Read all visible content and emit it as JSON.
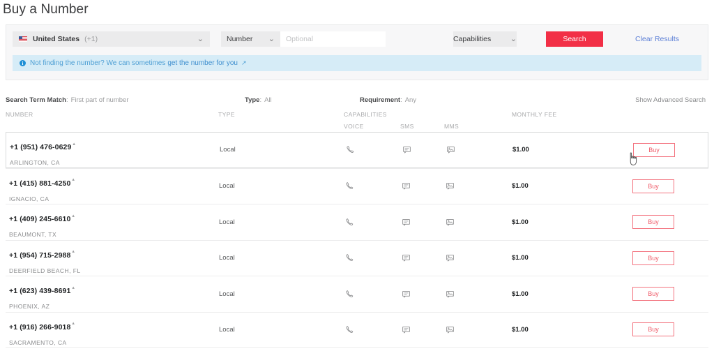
{
  "page_title": "Buy a Number",
  "search": {
    "country": {
      "icon": "us-flag-icon",
      "name": "United States",
      "dial_code": "(+1)",
      "chevron": "⌄"
    },
    "type_select": {
      "value": "Number",
      "chevron": "⌄"
    },
    "term_input": {
      "value": "",
      "placeholder": "Optional"
    },
    "capabilities_button": {
      "label": "Capabilities",
      "chevron": "⌄"
    },
    "search_button": "Search",
    "clear_results": "Clear Results"
  },
  "info_banner": {
    "icon": "info-icon",
    "text": "Not finding the number? We can sometimes",
    "link_text": "get the number for you",
    "external_arrow": "↗"
  },
  "filters": {
    "search_term_match": {
      "label": "Search Term Match",
      "value": "First part of number"
    },
    "type": {
      "label": "Type",
      "value": "All"
    },
    "requirement": {
      "label": "Requirement",
      "value": "Any"
    },
    "advanced_search_link": "Show Advanced Search"
  },
  "table": {
    "headers": {
      "number": "NUMBER",
      "type": "TYPE",
      "capabilities": "CAPABILITIES",
      "voice": "VOICE",
      "sms": "SMS",
      "mms": "MMS",
      "monthly_fee": "MONTHLY FEE"
    },
    "buy_label": "Buy",
    "superscript": "▴",
    "rows": [
      {
        "number": "+1 (951) 476-0629",
        "location": "ARLINGTON, CA",
        "type": "Local",
        "voice": true,
        "sms": true,
        "mms": true,
        "monthly_fee": "$1.00",
        "hovered": true
      },
      {
        "number": "+1 (415) 881-4250",
        "location": "IGNACIO, CA",
        "type": "Local",
        "voice": true,
        "sms": true,
        "mms": true,
        "monthly_fee": "$1.00",
        "hovered": false
      },
      {
        "number": "+1 (409) 245-6610",
        "location": "BEAUMONT, TX",
        "type": "Local",
        "voice": true,
        "sms": true,
        "mms": true,
        "monthly_fee": "$1.00",
        "hovered": false
      },
      {
        "number": "+1 (954) 715-2988",
        "location": "DEERFIELD BEACH, FL",
        "type": "Local",
        "voice": true,
        "sms": true,
        "mms": true,
        "monthly_fee": "$1.00",
        "hovered": false
      },
      {
        "number": "+1 (623) 439-8691",
        "location": "PHOENIX, AZ",
        "type": "Local",
        "voice": true,
        "sms": true,
        "mms": true,
        "monthly_fee": "$1.00",
        "hovered": false
      },
      {
        "number": "+1 (916) 266-9018",
        "location": "SACRAMENTO, CA",
        "type": "Local",
        "voice": true,
        "sms": true,
        "mms": true,
        "monthly_fee": "$1.00",
        "hovered": false
      }
    ]
  },
  "colors": {
    "accent_red": "#f22f46",
    "buy_border": "#f3737f",
    "link_blue": "#5c7fd6",
    "banner_bg": "#d6ecf7",
    "panel_bg": "#f7f7f8"
  }
}
